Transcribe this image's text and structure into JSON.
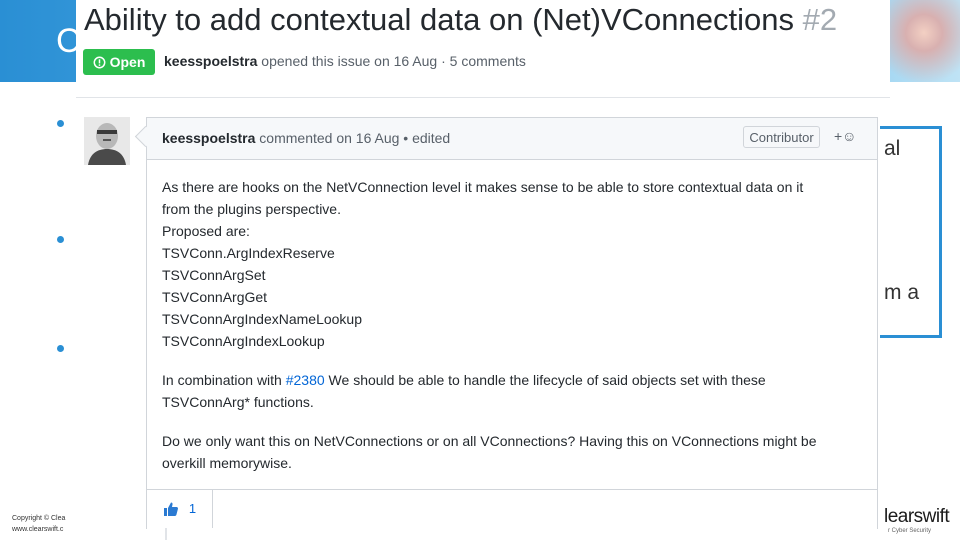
{
  "slide": {
    "title_letter": "C",
    "fragment_1": "al",
    "fragment_2": "m a",
    "footer_line1": "Copyright © Clea",
    "footer_line2": "www.clearswift.c",
    "logo_text": "learswift",
    "logo_sub": "r Cyber Security"
  },
  "issue": {
    "title": "Ability to add contextual data on (Net)VConnections",
    "number": "#2",
    "status": "Open",
    "author": "keesspoelstra",
    "meta_text": "opened this issue on 16 Aug · 5 comments"
  },
  "comment": {
    "author": "keesspoelstra",
    "header_text": "commented on 16 Aug • edited",
    "role_badge": "Contributor",
    "add_reaction": "+☺",
    "lines": [
      "As there are hooks on the NetVConnection level it makes sense to be able to store contextual data on it",
      "from the plugins perspective.",
      "Proposed are:",
      "TSVConn.ArgIndexReserve",
      "TSVConnArgSet",
      "TSVConnArgGet",
      "TSVConnArgIndexNameLookup",
      "TSVConnArgIndexLookup"
    ],
    "combo_prefix": "In combination with ",
    "combo_link": "#2380",
    "combo_suffix": " We should be able to handle the lifecycle of said objects set with these",
    "combo_line2": "TSVConnArg* functions.",
    "question_line1": "Do we only want this on NetVConnections or on all VConnections? Having this on VConnections might be",
    "question_line2": "overkill memorywise.",
    "reaction": {
      "icon": "thumbs-up-icon",
      "count": "1"
    }
  },
  "colors": {
    "accent": "#2a8fd4",
    "open_badge": "#2cbe4e",
    "link": "#0366d6"
  }
}
